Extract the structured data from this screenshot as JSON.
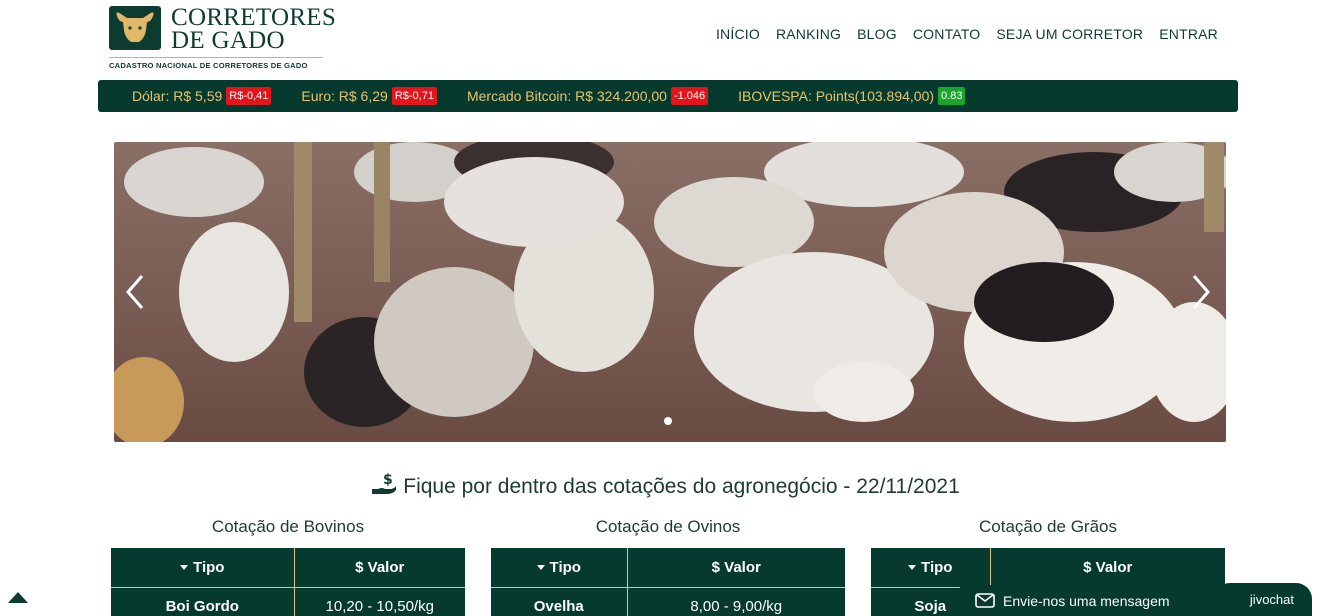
{
  "brand": {
    "title_line1": "CORRETORES",
    "title_line2": "DE GADO",
    "subtitle": "CADASTRO NACIONAL DE CORRETORES DE GADO"
  },
  "nav": {
    "items": [
      {
        "label": "INÍCIO"
      },
      {
        "label": "RANKING"
      },
      {
        "label": "BLOG"
      },
      {
        "label": "CONTATO"
      },
      {
        "label": "SEJA UM CORRETOR"
      },
      {
        "label": "ENTRAR"
      }
    ]
  },
  "ticker": {
    "items": [
      {
        "label": "Dólar: R$ 5,59",
        "change": "R$-0,41",
        "trend": "down"
      },
      {
        "label": "Euro: R$ 6,29",
        "change": "R$-0,71",
        "trend": "down"
      },
      {
        "label": "Mercado Bitcoin: R$ 324.200,00",
        "change": "-1.046",
        "trend": "down"
      },
      {
        "label": "IBOVESPA: Points(103.894,00)",
        "change": "0.83",
        "trend": "up"
      }
    ],
    "colors": {
      "down": "#e3141b",
      "up": "#1aa52b",
      "text": "#e7c46c",
      "bar": "#063a2f"
    }
  },
  "carousel": {
    "slide_count": 1,
    "active_slide": 1,
    "image": "cattle-in-corral-photo"
  },
  "section": {
    "title": "Fique por dentro das cotações do agronegócio - 22/11/2021",
    "icon": "hand-money-icon"
  },
  "quotes": {
    "bovinos": {
      "title": "Cotação de Bovinos",
      "col_type": "Tipo",
      "col_value": "$ Valor",
      "rows": [
        {
          "type": "Boi Gordo",
          "value": "10,20 - 10,50/kg"
        }
      ]
    },
    "ovinos": {
      "title": "Cotação de Ovinos",
      "col_type": "Tipo",
      "col_value": "$ Valor",
      "rows": [
        {
          "type": "Ovelha",
          "value": "8,00 - 9,00/kg"
        }
      ]
    },
    "graos": {
      "title": "Cotação de Grãos",
      "col_type": "Tipo",
      "col_value": "$ Valor",
      "rows": [
        {
          "type": "Soja",
          "value": ""
        }
      ]
    }
  },
  "chat": {
    "label": "Envie-nos uma mensagem",
    "brand": "jivochat"
  },
  "theme": {
    "primary": "#063a2f",
    "accent": "#d6c48f"
  }
}
